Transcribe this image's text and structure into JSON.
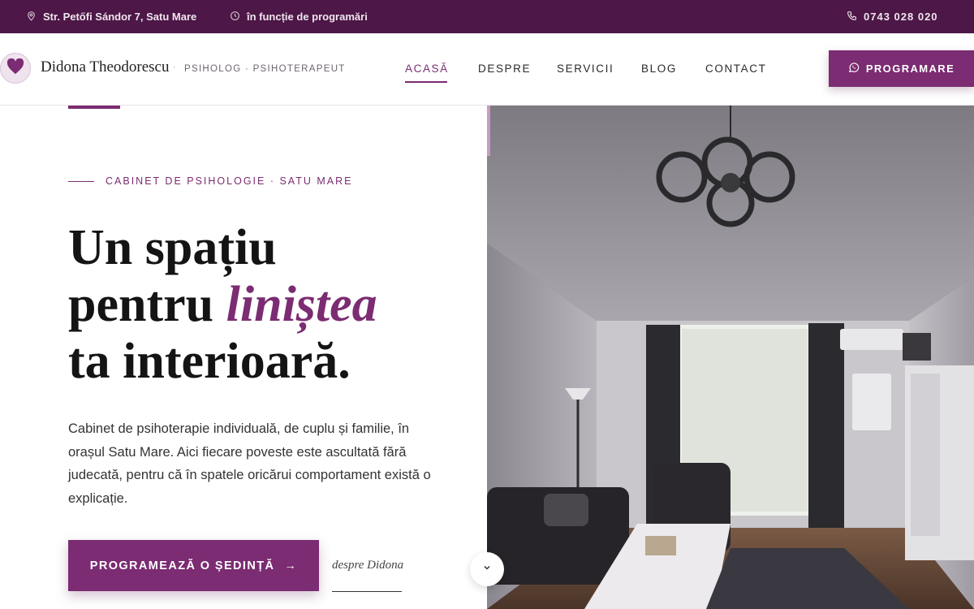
{
  "topbar": {
    "address": "Str. Petőfi Sándor 7, Satu Mare",
    "schedule": "în funcție de programări",
    "phone": "0743 028 020",
    "icons": [
      "location-pin-icon",
      "clock-icon",
      "phone-icon"
    ]
  },
  "header": {
    "brand_name": "Didona Theodorescu",
    "brand_separator": "·",
    "brand_tagline": "PSIHOLOG · PSIHOTERAPEUT",
    "logo_icon": "heart-icon",
    "nav": [
      {
        "label": "ACASĂ",
        "active": true
      },
      {
        "label": "DESPRE",
        "active": false
      },
      {
        "label": "SERVICII",
        "active": false
      },
      {
        "label": "BLOG",
        "active": false
      },
      {
        "label": "CONTACT",
        "active": false
      }
    ],
    "cta_label": "PROGRAMARE",
    "cta_icon": "whatsapp-icon"
  },
  "hero": {
    "eyebrow": "CABINET DE PSIHOLOGIE · SATU MARE",
    "headline_line1": "Un spațiu",
    "headline_line2_prefix": "pentru ",
    "headline_line2_emphasis": "liniștea",
    "headline_line3": "ta interioară.",
    "lead": "Cabinet de psihoterapie individuală, de cuplu și familie, în orașul Satu Mare. Aici fiecare poveste este ascultată fără judecată, pentru că în spatele oricărui comportament există o explicație.",
    "cta_label": "PROGRAMEAZĂ O ȘEDINȚĂ",
    "cta_arrow": "→",
    "secondary_link": "despre Didona",
    "scroll_icon": "chevron-down-icon"
  },
  "colors": {
    "topbar_bg": "#4d1747",
    "accent": "#7b2c72",
    "text_dark": "#141414"
  }
}
